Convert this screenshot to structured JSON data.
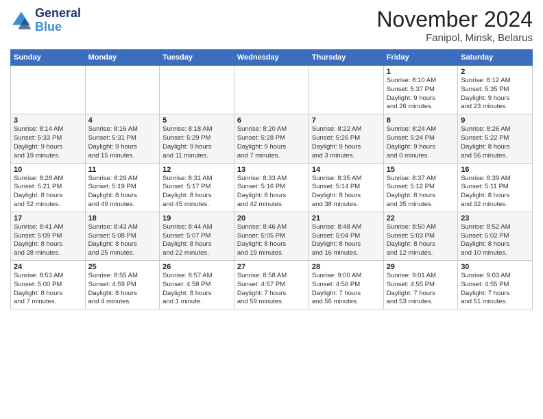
{
  "header": {
    "logo_line1": "General",
    "logo_line2": "Blue",
    "title": "November 2024",
    "subtitle": "Fanipol, Minsk, Belarus"
  },
  "columns": [
    "Sunday",
    "Monday",
    "Tuesday",
    "Wednesday",
    "Thursday",
    "Friday",
    "Saturday"
  ],
  "weeks": [
    {
      "days": [
        {
          "num": "",
          "info": ""
        },
        {
          "num": "",
          "info": ""
        },
        {
          "num": "",
          "info": ""
        },
        {
          "num": "",
          "info": ""
        },
        {
          "num": "",
          "info": ""
        },
        {
          "num": "1",
          "info": "Sunrise: 8:10 AM\nSunset: 5:37 PM\nDaylight: 9 hours\nand 26 minutes."
        },
        {
          "num": "2",
          "info": "Sunrise: 8:12 AM\nSunset: 5:35 PM\nDaylight: 9 hours\nand 23 minutes."
        }
      ]
    },
    {
      "days": [
        {
          "num": "3",
          "info": "Sunrise: 8:14 AM\nSunset: 5:33 PM\nDaylight: 9 hours\nand 19 minutes."
        },
        {
          "num": "4",
          "info": "Sunrise: 8:16 AM\nSunset: 5:31 PM\nDaylight: 9 hours\nand 15 minutes."
        },
        {
          "num": "5",
          "info": "Sunrise: 8:18 AM\nSunset: 5:29 PM\nDaylight: 9 hours\nand 11 minutes."
        },
        {
          "num": "6",
          "info": "Sunrise: 8:20 AM\nSunset: 5:28 PM\nDaylight: 9 hours\nand 7 minutes."
        },
        {
          "num": "7",
          "info": "Sunrise: 8:22 AM\nSunset: 5:26 PM\nDaylight: 9 hours\nand 3 minutes."
        },
        {
          "num": "8",
          "info": "Sunrise: 8:24 AM\nSunset: 5:24 PM\nDaylight: 9 hours\nand 0 minutes."
        },
        {
          "num": "9",
          "info": "Sunrise: 8:26 AM\nSunset: 5:22 PM\nDaylight: 8 hours\nand 56 minutes."
        }
      ]
    },
    {
      "days": [
        {
          "num": "10",
          "info": "Sunrise: 8:28 AM\nSunset: 5:21 PM\nDaylight: 8 hours\nand 52 minutes."
        },
        {
          "num": "11",
          "info": "Sunrise: 8:29 AM\nSunset: 5:19 PM\nDaylight: 8 hours\nand 49 minutes."
        },
        {
          "num": "12",
          "info": "Sunrise: 8:31 AM\nSunset: 5:17 PM\nDaylight: 8 hours\nand 45 minutes."
        },
        {
          "num": "13",
          "info": "Sunrise: 8:33 AM\nSunset: 5:16 PM\nDaylight: 8 hours\nand 42 minutes."
        },
        {
          "num": "14",
          "info": "Sunrise: 8:35 AM\nSunset: 5:14 PM\nDaylight: 8 hours\nand 38 minutes."
        },
        {
          "num": "15",
          "info": "Sunrise: 8:37 AM\nSunset: 5:12 PM\nDaylight: 8 hours\nand 35 minutes."
        },
        {
          "num": "16",
          "info": "Sunrise: 8:39 AM\nSunset: 5:11 PM\nDaylight: 8 hours\nand 32 minutes."
        }
      ]
    },
    {
      "days": [
        {
          "num": "17",
          "info": "Sunrise: 8:41 AM\nSunset: 5:09 PM\nDaylight: 8 hours\nand 28 minutes."
        },
        {
          "num": "18",
          "info": "Sunrise: 8:43 AM\nSunset: 5:08 PM\nDaylight: 8 hours\nand 25 minutes."
        },
        {
          "num": "19",
          "info": "Sunrise: 8:44 AM\nSunset: 5:07 PM\nDaylight: 8 hours\nand 22 minutes."
        },
        {
          "num": "20",
          "info": "Sunrise: 8:46 AM\nSunset: 5:05 PM\nDaylight: 8 hours\nand 19 minutes."
        },
        {
          "num": "21",
          "info": "Sunrise: 8:48 AM\nSunset: 5:04 PM\nDaylight: 8 hours\nand 16 minutes."
        },
        {
          "num": "22",
          "info": "Sunrise: 8:50 AM\nSunset: 5:03 PM\nDaylight: 8 hours\nand 12 minutes."
        },
        {
          "num": "23",
          "info": "Sunrise: 8:52 AM\nSunset: 5:02 PM\nDaylight: 8 hours\nand 10 minutes."
        }
      ]
    },
    {
      "days": [
        {
          "num": "24",
          "info": "Sunrise: 8:53 AM\nSunset: 5:00 PM\nDaylight: 8 hours\nand 7 minutes."
        },
        {
          "num": "25",
          "info": "Sunrise: 8:55 AM\nSunset: 4:59 PM\nDaylight: 8 hours\nand 4 minutes."
        },
        {
          "num": "26",
          "info": "Sunrise: 8:57 AM\nSunset: 4:58 PM\nDaylight: 8 hours\nand 1 minute."
        },
        {
          "num": "27",
          "info": "Sunrise: 8:58 AM\nSunset: 4:57 PM\nDaylight: 7 hours\nand 59 minutes."
        },
        {
          "num": "28",
          "info": "Sunrise: 9:00 AM\nSunset: 4:56 PM\nDaylight: 7 hours\nand 56 minutes."
        },
        {
          "num": "29",
          "info": "Sunrise: 9:01 AM\nSunset: 4:55 PM\nDaylight: 7 hours\nand 53 minutes."
        },
        {
          "num": "30",
          "info": "Sunrise: 9:03 AM\nSunset: 4:55 PM\nDaylight: 7 hours\nand 51 minutes."
        }
      ]
    }
  ]
}
